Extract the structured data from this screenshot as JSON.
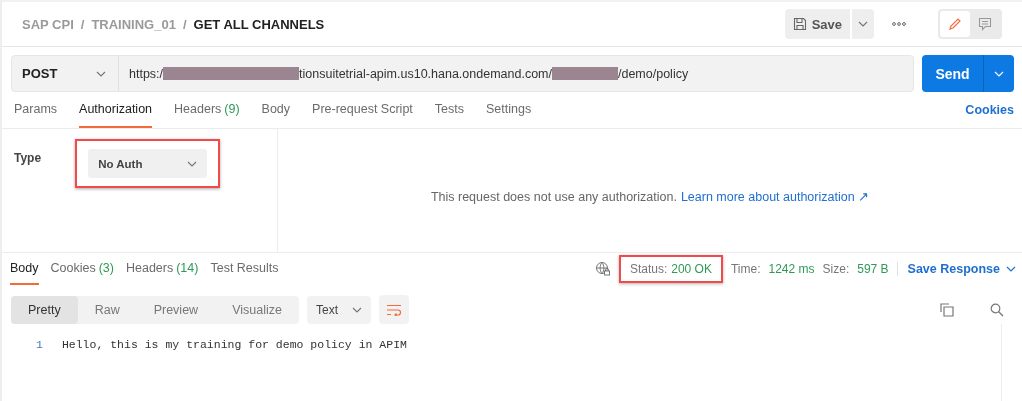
{
  "breadcrumb": [
    {
      "label": "SAP CPI",
      "current": false
    },
    {
      "label": "TRAINING_01",
      "current": false
    },
    {
      "label": "GET ALL CHANNELS",
      "current": true
    }
  ],
  "breadcrumb_separator": "/",
  "header": {
    "save": "Save",
    "modes": [
      {
        "kind": "edit",
        "selected": true
      },
      {
        "kind": "comments",
        "selected": false
      }
    ]
  },
  "request": {
    "method": "POST",
    "url": [
      {
        "kind": "text",
        "text": "https:/"
      },
      {
        "kind": "redacted"
      },
      {
        "kind": "text",
        "text": "tionsuitetrial-apim.us10.hana.ondemand.com/"
      },
      {
        "kind": "redacted"
      },
      {
        "kind": "text",
        "text": "/demo/policy"
      }
    ],
    "send": "Send"
  },
  "request_tabs": [
    {
      "label": "Params",
      "selected": false
    },
    {
      "label": "Authorization",
      "selected": true
    },
    {
      "label": "Headers",
      "count": "(9)",
      "selected": false
    },
    {
      "label": "Body",
      "selected": false
    },
    {
      "label": "Pre-request Script",
      "selected": false
    },
    {
      "label": "Tests",
      "selected": false
    },
    {
      "label": "Settings",
      "selected": false
    }
  ],
  "cookies_link": "Cookies",
  "authorization": {
    "type_label": "Type",
    "type_value": "No Auth",
    "highlighted": true,
    "message": "This request does not use any authorization.",
    "link": "Learn more about authorization ↗"
  },
  "response_tabs": [
    {
      "label": "Body",
      "selected": true
    },
    {
      "label": "Cookies",
      "count": "(3)",
      "selected": false
    },
    {
      "label": "Headers",
      "count": "(14)",
      "selected": false
    },
    {
      "label": "Test Results",
      "selected": false
    }
  ],
  "response_meta": {
    "status_label": "Status:",
    "status": "200 OK",
    "status_highlighted": true,
    "time_label": "Time:",
    "time": "1242 ms",
    "size_label": "Size:",
    "size": "597 B",
    "save_response": "Save Response"
  },
  "view_modes": [
    {
      "label": "Pretty",
      "selected": true
    },
    {
      "label": "Raw",
      "selected": false
    },
    {
      "label": "Preview",
      "selected": false
    },
    {
      "label": "Visualize",
      "selected": false
    }
  ],
  "format": "Text",
  "body_lines": [
    {
      "number": "1",
      "text": "Hello, this is my training for demo policy in APIM"
    }
  ]
}
